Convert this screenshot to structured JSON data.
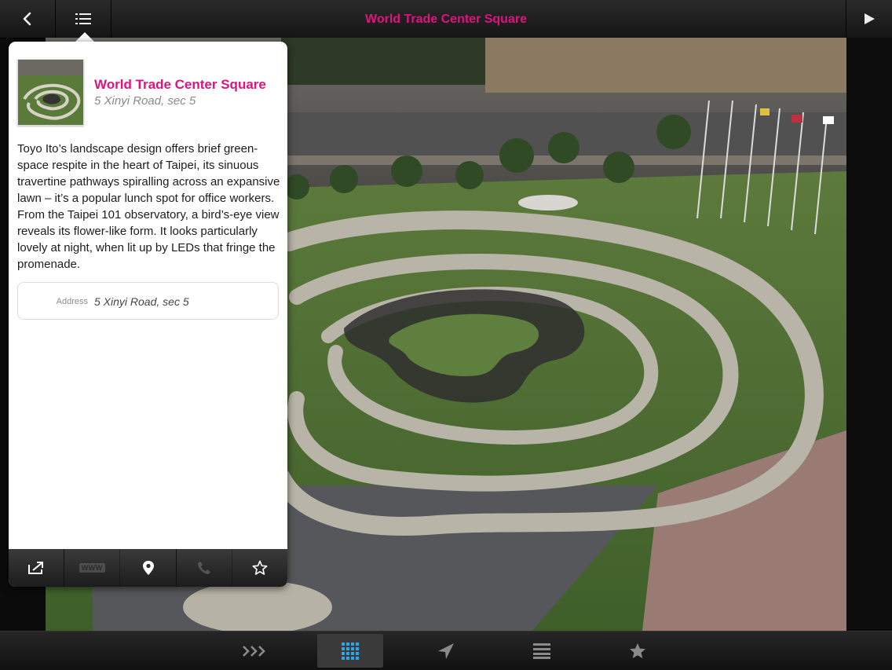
{
  "header": {
    "title": "World Trade Center Square",
    "back_icon": "chevron-left-icon",
    "menu_icon": "list-icon",
    "play_icon": "play-icon"
  },
  "popover": {
    "title": "World Trade Center Square",
    "subtitle": "5 Xinyi Road, sec 5",
    "description": "Toyo Ito’s landscape design offers brief green-space respite in the heart of Taipei, its sinuous travertine pathways spiralling across an expansive lawn – it’s a popular lunch spot for office workers. From the Taipei 101 observatory, a bird’s-eye view reveals its flower-like form. It looks particularly lovely at night, when lit up by LEDs that fringe the promenade.",
    "address_label": "Address",
    "address_value": "5 Xinyi Road, sec 5",
    "toolbar": {
      "share_icon": "share-external-icon",
      "www_label": "WWW",
      "map_icon": "map-pin-icon",
      "phone_icon": "phone-icon",
      "favorite_icon": "star-outline-icon"
    }
  },
  "bottom_nav": {
    "items": [
      {
        "icon": "chevrons-right-icon",
        "active": false
      },
      {
        "icon": "grid-icon",
        "active": true
      },
      {
        "icon": "location-arrow-icon",
        "active": false
      },
      {
        "icon": "list-icon",
        "active": false
      },
      {
        "icon": "star-icon",
        "active": false
      }
    ]
  },
  "colors": {
    "accent": "#e2117f",
    "active_icon": "#2aa7e8",
    "bar_bg": "#1c1c1c"
  }
}
